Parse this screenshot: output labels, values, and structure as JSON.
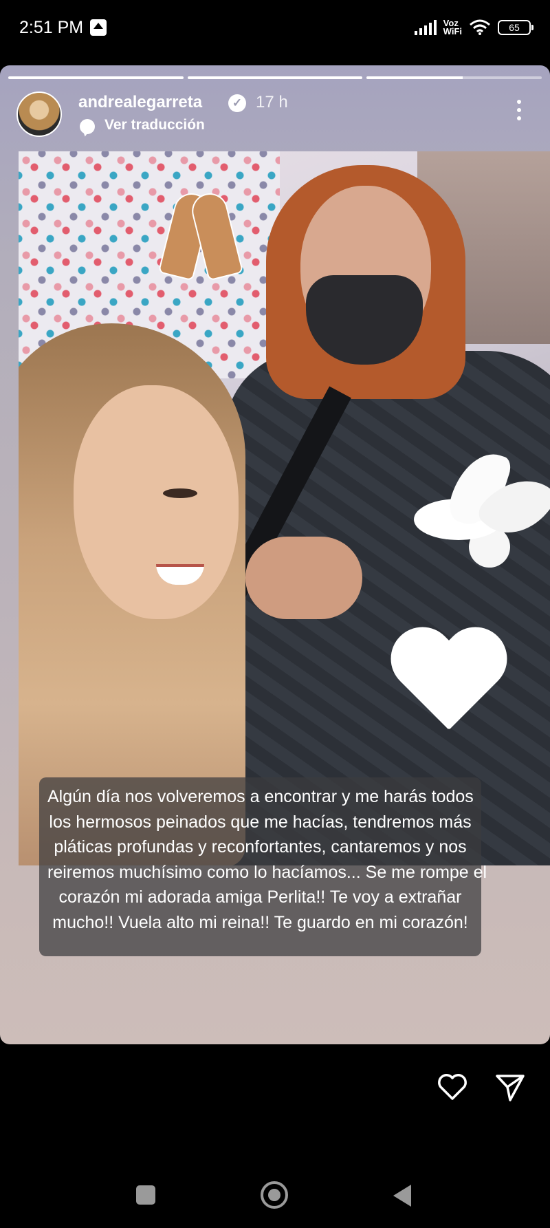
{
  "status_bar": {
    "time": "2:51 PM",
    "network_label_1": "Voz",
    "network_label_2": "WiFi",
    "battery": "65"
  },
  "story": {
    "progress": [
      1.0,
      1.0,
      0.55
    ],
    "username": "andrealegarreta",
    "time_ago": "17 h",
    "translate_label": "Ver traducción",
    "caption_lines": [
      "Algún día nos volveremos a encontrar y me harás todos",
      "los hermosos peinados que me hacías, tendremos más",
      "pláticas profundas y reconfortantes, cantaremos y nos",
      "reiremos muchísimo como lo hacíamos... Se me rompe el",
      "corazón mi adorada amiga Perlita!! Te voy a extrañar",
      "mucho!! Vuela alto mi reina!!  Te guardo en mi corazón!"
    ],
    "stickers": [
      "pray-icon",
      "dove-icon",
      "heart-icon"
    ]
  },
  "actions": {
    "icons": [
      "heart-outline-icon",
      "send-icon"
    ]
  },
  "nav": {
    "icons": [
      "nav-recent-icon",
      "nav-home-icon",
      "nav-back-icon"
    ]
  },
  "colors": {
    "background": "#000000",
    "story_tint": "#b4afc0",
    "caption_bg": "#3c3c3e"
  }
}
